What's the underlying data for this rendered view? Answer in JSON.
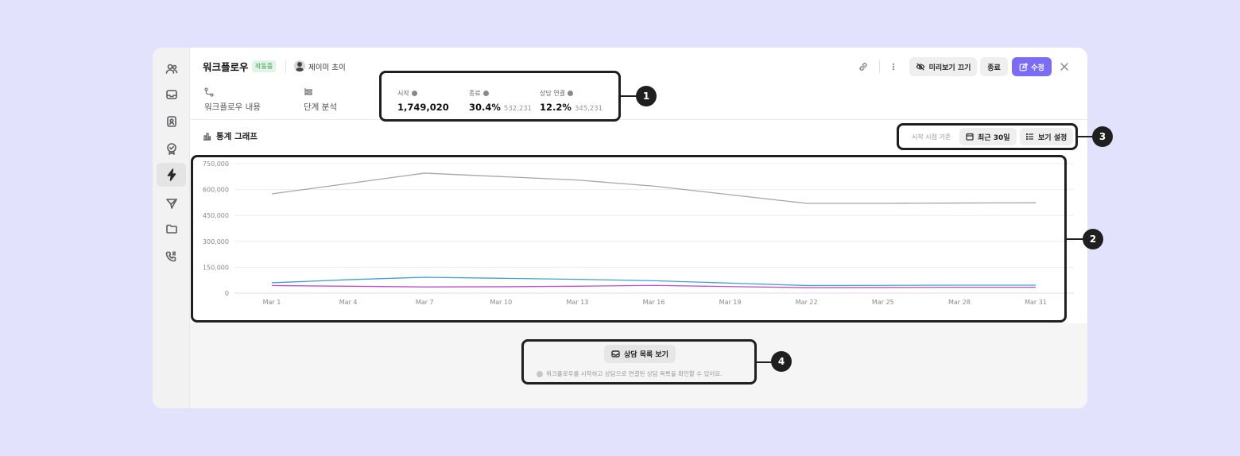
{
  "header": {
    "title": "워크플로우",
    "status_badge": "작동중",
    "owner": "제이미 초이",
    "preview_off_label": "미리보기 끄기",
    "end_label": "종료",
    "edit_label": "수정"
  },
  "tabs": [
    {
      "label": "워크플로우 내용",
      "icon": "workflow-icon"
    },
    {
      "label": "단계 분석",
      "icon": "steps-icon"
    }
  ],
  "metrics": [
    {
      "label": "시작",
      "value": "1,749,020",
      "sub": ""
    },
    {
      "label": "종료",
      "value": "30.4%",
      "sub": "532,231"
    },
    {
      "label": "상담 연결",
      "value": "12.2%",
      "sub": "345,231"
    }
  ],
  "stats": {
    "title": "통계 그래프",
    "basis_label": "시작 시점 기준",
    "range_label": "최근 30일",
    "view_settings_label": "보기 설정"
  },
  "footer": {
    "list_button_label": "상담 목록 보기",
    "note": "워크플로우를 시작하고 상담으로 연결된 상담 목록을 확인할 수 있어요."
  },
  "callouts": [
    "1",
    "2",
    "3",
    "4"
  ],
  "colors": {
    "accent": "#7b6cf6",
    "badge_text": "#2d9a4b",
    "callout": "#1f1f1f"
  },
  "chart_data": {
    "type": "line",
    "x": [
      "Mar 1",
      "Mar 4",
      "Mar 7",
      "Mar 10",
      "Mar 13",
      "Mar 16",
      "Mar 19",
      "Mar 22",
      "Mar 25",
      "Mar 28",
      "Mar 31"
    ],
    "yticks": [
      "750,000",
      "600,000",
      "450,000",
      "300,000",
      "150,000",
      "0"
    ],
    "ylim": [
      0,
      750000
    ],
    "grid": true,
    "series": [
      {
        "color": "#a6a6a6",
        "values": [
          575000,
          635000,
          695000,
          675000,
          655000,
          620000,
          570000,
          520000,
          520000,
          522000,
          523000
        ]
      },
      {
        "color": "#3fa0d6",
        "values": [
          60000,
          78000,
          92000,
          86000,
          80000,
          72000,
          58000,
          44000,
          45000,
          46000,
          46000
        ]
      },
      {
        "color": "#c04fd0",
        "values": [
          44000,
          40000,
          36000,
          37000,
          40000,
          45000,
          38000,
          32000,
          33000,
          34000,
          34000
        ]
      }
    ]
  }
}
